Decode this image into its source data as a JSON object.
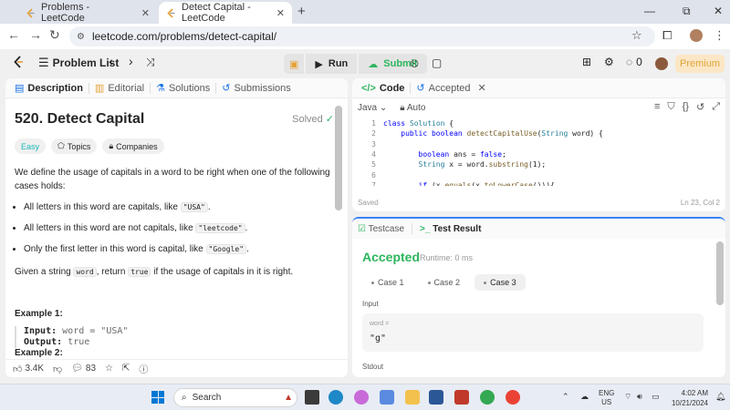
{
  "browser": {
    "tabs": [
      {
        "title": "Problems - LeetCode"
      },
      {
        "title": "Detect Capital - LeetCode"
      }
    ],
    "url": "leetcode.com/problems/detect-capital/"
  },
  "header": {
    "problem_list": "Problem List",
    "run": "Run",
    "submit": "Submit",
    "notif_count": "0",
    "premium": "Premium"
  },
  "left_tabs": [
    "Description",
    "Editorial",
    "Solutions",
    "Submissions"
  ],
  "problem": {
    "title": "520. Detect Capital",
    "status": "Solved",
    "difficulty": "Easy",
    "topics": "Topics",
    "companies": "Companies",
    "intro": "We define the usage of capitals in a word to be right when one of the following cases holds:",
    "bullets": [
      {
        "text": "All letters in this word are capitals, like ",
        "code": "\"USA\"",
        "end": "."
      },
      {
        "text": "All letters in this word are not capitals, like ",
        "code": "\"leetcode\"",
        "end": "."
      },
      {
        "text": "Only the first letter in this word is capital, like ",
        "code": "\"Google\"",
        "end": "."
      }
    ],
    "given_pre": "Given a string ",
    "given_code1": "word",
    "given_mid": ", return ",
    "given_code2": "true",
    "given_post": " if the usage of capitals in it is right.",
    "example1_title": "Example 1:",
    "example1_input_label": "Input:",
    "example1_input": "word = \"USA\"",
    "example1_output_label": "Output:",
    "example1_output": "true",
    "example2_title": "Example 2:"
  },
  "footer": {
    "likes": "3.4K",
    "comments": "83"
  },
  "code_tabs": {
    "code": "Code",
    "accepted": "Accepted"
  },
  "editor": {
    "language": "Java",
    "mode": "Auto",
    "saved": "Saved",
    "position": "Ln 23, Col 2"
  },
  "code_lines": [
    "1",
    "2",
    "3",
    "4",
    "5",
    "6",
    "7"
  ],
  "result_tabs": {
    "testcase": "Testcase",
    "result": "Test Result"
  },
  "result": {
    "status": "Accepted",
    "runtime": "Runtime: 0 ms",
    "cases": [
      "Case 1",
      "Case 2",
      "Case 3"
    ],
    "input_label": "Input",
    "var_name": "word =",
    "var_value": "\"g\"",
    "stdout_label": "Stdout"
  },
  "taskbar": {
    "search": "Search",
    "lang_top": "ENG",
    "lang_bottom": "US",
    "time": "4:02 AM",
    "date": "10/21/2024"
  }
}
